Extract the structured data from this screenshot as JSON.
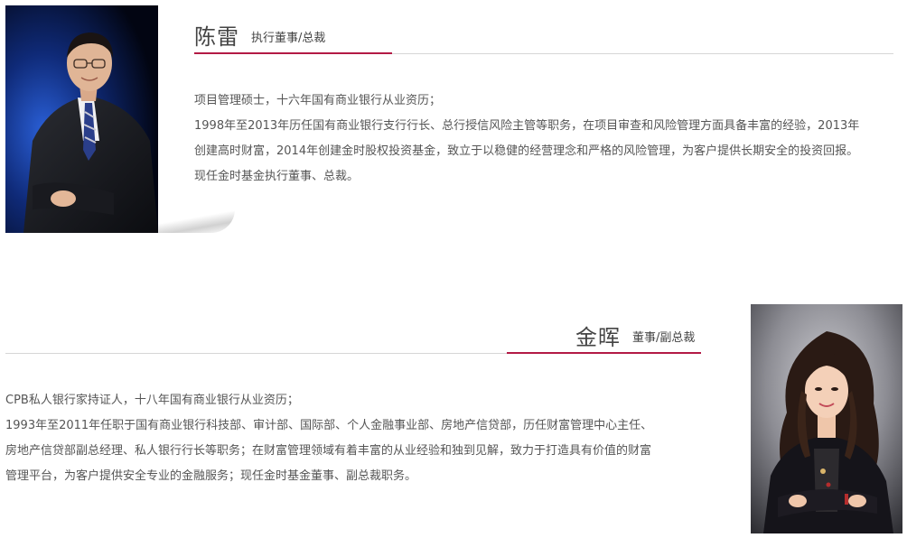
{
  "person1": {
    "name": "陈雷",
    "role": "执行董事/总裁",
    "bio": [
      "项目管理硕士，十六年国有商业银行从业资历；",
      "1998年至2013年历任国有商业银行支行行长、总行授信风险主管等职务，在项目审查和风险管理方面具备丰富的经验，2013年",
      "创建高时财富，2014年创建金时股权投资基金，致立于以稳健的经营理念和严格的风险管理，为客户提供长期安全的投资回报。",
      "现任金时基金执行董事、总裁。"
    ]
  },
  "person2": {
    "name": "金晖",
    "role": "董事/副总裁",
    "bio": [
      "CPB私人银行家持证人，十八年国有商业银行从业资历；",
      "1993年至2011年任职于国有商业银行科技部、审计部、国际部、个人金融事业部、房地产信贷部，历任财富管理中心主任、",
      "房地产信贷部副总经理、私人银行行长等职务；在财富管理领域有着丰富的从业经验和独到见解，致力于打造具有价值的财富",
      "管理平台，为客户提供安全专业的金融服务；现任金时基金董事、副总裁职务。"
    ]
  },
  "colors": {
    "accent": "#b31a45",
    "rule": "#d6d6d6",
    "text": "#555555"
  }
}
